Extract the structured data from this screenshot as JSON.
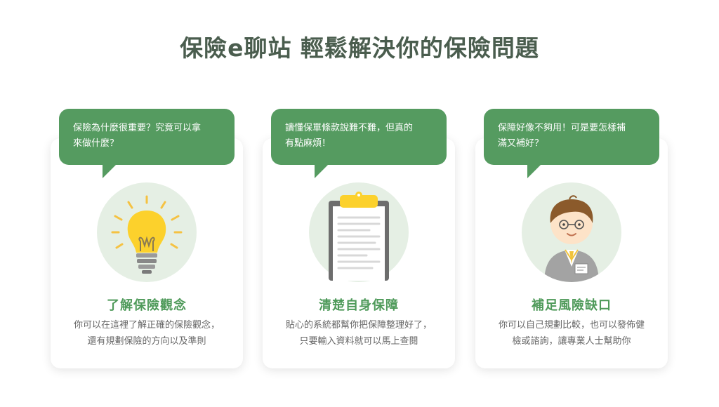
{
  "page": {
    "title": "保險e聊站 輕鬆解決你的保險問題"
  },
  "colors": {
    "accent_green": "#559b60",
    "title_gray": "#4a5d4e",
    "circle_bg": "#e5efe4"
  },
  "cards": [
    {
      "bubble_line1": "保險為什麼很重要？究竟可以拿",
      "bubble_line2": "來做什麼？",
      "icon": "lightbulb-icon",
      "title": "了解保險觀念",
      "desc_line1": "你可以在這裡了解正確的保險觀念，",
      "desc_line2": "還有規劃保險的方向以及準則"
    },
    {
      "bubble_line1": "讀懂保單條款說難不難，但真的",
      "bubble_line2": "有點麻煩！",
      "icon": "clipboard-icon",
      "title": "清楚自身保障",
      "desc_line1": "貼心的系統都幫你把保障整理好了，",
      "desc_line2": "只要輸入資料就可以馬上查閱"
    },
    {
      "bubble_line1": "保障好像不夠用！可是要怎樣補",
      "bubble_line2": "滿又補好？",
      "icon": "advisor-icon",
      "title": "補足風險缺口",
      "desc_line1": "你可以自己規劃比較，也可以發佈健",
      "desc_line2": "檢或諮詢，讓專業人士幫助你"
    }
  ]
}
